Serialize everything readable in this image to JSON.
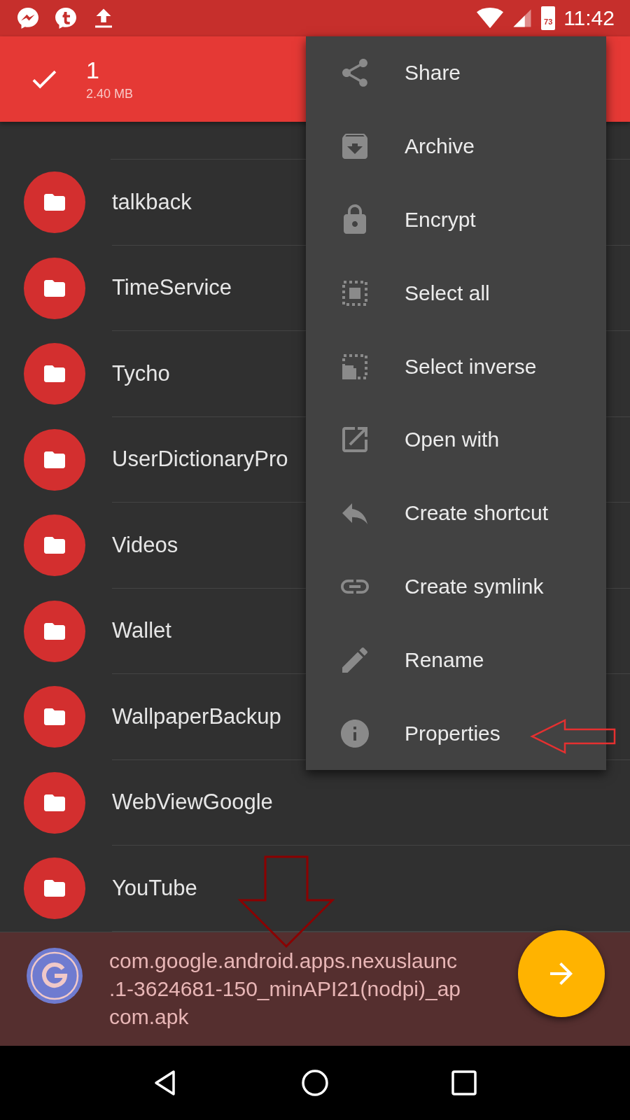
{
  "status_bar": {
    "battery": "73",
    "time": "11:42"
  },
  "selection_bar": {
    "count": "1",
    "size": "2.40 MB"
  },
  "files": [
    {
      "name": "talkback"
    },
    {
      "name": "TimeService"
    },
    {
      "name": "Tycho"
    },
    {
      "name": "UserDictionaryPro"
    },
    {
      "name": "Videos"
    },
    {
      "name": "Wallet"
    },
    {
      "name": "WallpaperBackup"
    },
    {
      "name": "WebViewGoogle"
    },
    {
      "name": "YouTube"
    }
  ],
  "menu": [
    {
      "label": "Share",
      "kind": "share"
    },
    {
      "label": "Archive",
      "kind": "archive"
    },
    {
      "label": "Encrypt",
      "kind": "lock"
    },
    {
      "label": "Select all",
      "kind": "select-all"
    },
    {
      "label": "Select inverse",
      "kind": "select-inverse"
    },
    {
      "label": "Open with",
      "kind": "open"
    },
    {
      "label": "Create shortcut",
      "kind": "shortcut"
    },
    {
      "label": "Create symlink",
      "kind": "link"
    },
    {
      "label": "Rename",
      "kind": "rename"
    },
    {
      "label": "Properties",
      "kind": "info"
    }
  ],
  "selected_file": {
    "lines": [
      "com.google.android.apps.nexuslaunc",
      ".1-3624681-150_minAPI21(nodpi)_ap",
      "com.apk"
    ]
  },
  "annotations": [
    {
      "kind": "arrow-left"
    },
    {
      "kind": "arrow-down"
    }
  ]
}
